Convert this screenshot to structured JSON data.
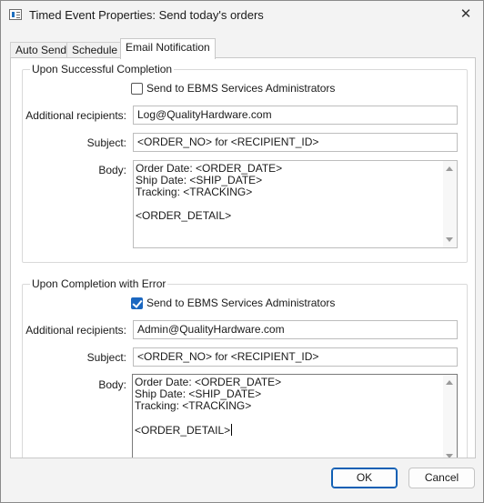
{
  "window": {
    "title": "Timed Event Properties: Send today's orders",
    "close_glyph": "✕"
  },
  "tabs": [
    {
      "label": "Auto Send",
      "active": false
    },
    {
      "label": "Schedule",
      "active": false
    },
    {
      "label": "Email Notification",
      "active": true
    }
  ],
  "success": {
    "group_title": "Upon Successful Completion",
    "send_admins": {
      "label": "Send to EBMS Services Administrators",
      "checked": false
    },
    "recipients_label": "Additional recipients:",
    "recipients_value": "Log@QualityHardware.com",
    "subject_label": "Subject:",
    "subject_value": "<ORDER_NO> for <RECIPIENT_ID>",
    "body_label": "Body:",
    "body_value": "Order Date: <ORDER_DATE>\nShip Date: <SHIP_DATE>\nTracking: <TRACKING>\n\n<ORDER_DETAIL>"
  },
  "error": {
    "group_title": "Upon Completion with Error",
    "send_admins": {
      "label": "Send to EBMS Services Administrators",
      "checked": true
    },
    "recipients_label": "Additional recipients:",
    "recipients_value": "Admin@QualityHardware.com",
    "subject_label": "Subject:",
    "subject_value": "<ORDER_NO> for <RECIPIENT_ID>",
    "body_label": "Body:",
    "body_value": "Order Date: <ORDER_DATE>\nShip Date: <SHIP_DATE>\nTracking: <TRACKING>\n\n<ORDER_DETAIL>"
  },
  "buttons": {
    "ok": "OK",
    "cancel": "Cancel"
  },
  "colors": {
    "accent": "#1b67c0"
  }
}
